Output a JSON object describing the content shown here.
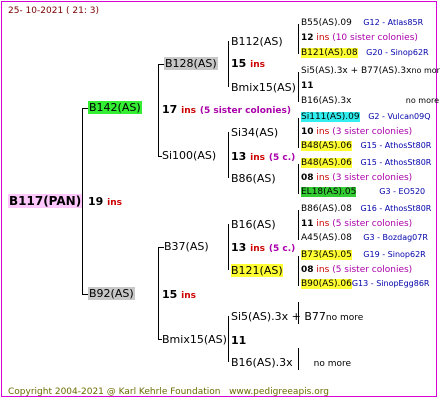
{
  "header": {
    "date": "25- 10-2021 ( 21: 3)"
  },
  "footer": {
    "copyright": "Copyright 2004-2021 @ Karl Kehrle Foundation",
    "site": "www.pedigreeapis.org"
  },
  "gen1": {
    "name": "B117(PAN)",
    "num": "19",
    "ins": "ins"
  },
  "gen2": [
    {
      "name": "B142(AS)",
      "num": "17",
      "ins": "ins",
      "note": "(5 sister colonies)"
    },
    {
      "name": "B92(AS)",
      "num": "15",
      "ins": "ins"
    }
  ],
  "gen3": [
    {
      "name": "B128(AS)",
      "num": "15",
      "ins": "ins"
    },
    {
      "name": "Si100(AS)",
      "num": "13",
      "ins": "ins",
      "note": "(5 c.)"
    },
    {
      "name": "B37(AS)",
      "num": "13",
      "ins": "ins",
      "note": "(5 c.)"
    },
    {
      "name": "Bmix15(AS)",
      "num": "11"
    }
  ],
  "gen4": [
    {
      "name": "B112(AS)"
    },
    {
      "name": "Bmix15(AS)",
      "num": "11"
    },
    {
      "name": "Si34(AS)"
    },
    {
      "name": "B86(AS)"
    },
    {
      "name": "B16(AS)",
      "num": "11",
      "ins": "ins",
      "note": "(5 sister colonies)"
    },
    {
      "name": "B121(AS)"
    },
    {
      "name": "Si5(AS).3x + B77",
      "note": "no more"
    },
    {
      "name": "B16(AS).3x",
      "note": "no more"
    }
  ],
  "gen5": [
    {
      "name": "B55(AS).09",
      "code": "G12 - Atlas85R"
    },
    {
      "name": "12",
      "ins": "ins",
      "note": "(10 sister colonies)"
    },
    {
      "name": "B121(AS).08",
      "code": "G20 - Sinop62R"
    },
    {
      "name": "Si5(AS).3x + B77(AS).3x",
      "note": "no more"
    },
    {
      "name": "11"
    },
    {
      "name": "B16(AS).3x",
      "note": "no more"
    },
    {
      "name": "Si111(AS).09",
      "code": "G2 - Vulcan09Q"
    },
    {
      "name": "10",
      "ins": "ins",
      "note": "(3 sister colonies)"
    },
    {
      "name": "B48(AS).06",
      "code": "G15 - AthosSt80R"
    },
    {
      "name": "B48(AS).06",
      "code": "G15 - AthosSt80R"
    },
    {
      "name": "08",
      "ins": "ins",
      "note": "(3 sister colonies)"
    },
    {
      "name": "EL18(AS).05",
      "code": "G3 - EO520"
    },
    {
      "name": "B86(AS).08",
      "code": "G16 - AthosSt80R"
    },
    {
      "name": "11",
      "ins": "ins",
      "note": "(5 sister colonies)"
    },
    {
      "name": "A45(AS).08",
      "code": "G3 - Bozdag07R"
    },
    {
      "name": "B73(AS).05",
      "code": "G19 - Sinop62R"
    },
    {
      "name": "08",
      "ins": "ins",
      "note": "(5 sister colonies)"
    },
    {
      "name": "B90(AS).06",
      "code": "G13 - SinopEgg86R"
    }
  ]
}
